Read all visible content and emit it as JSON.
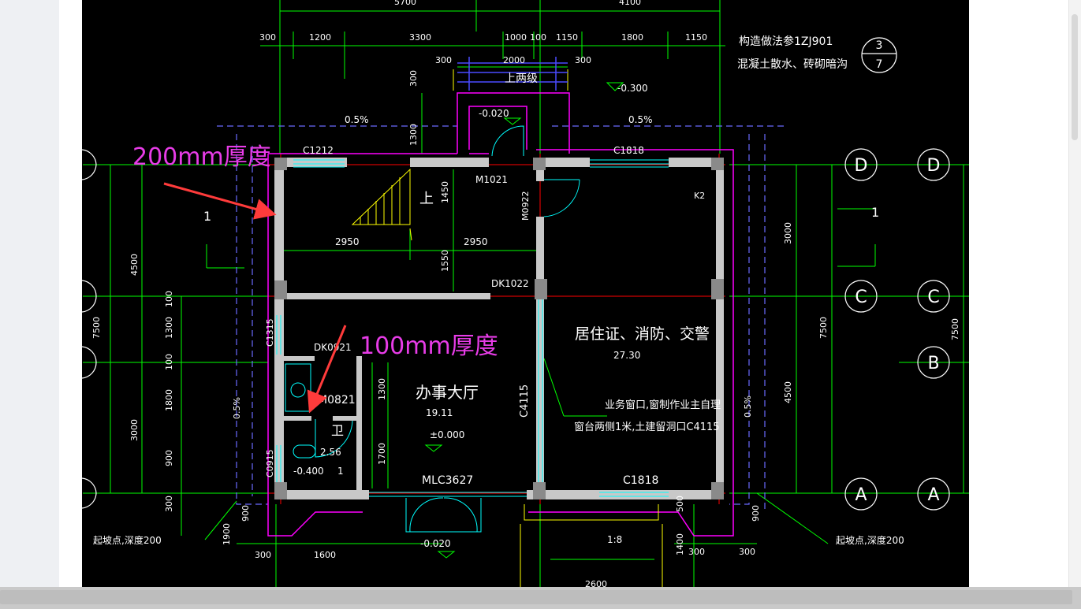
{
  "annotations": {
    "wall_200": "200mm厚度",
    "wall_100": "100mm厚度"
  },
  "notes": {
    "construction_ref": "构造做法参1ZJ901",
    "construction_sub": "混凝土散水、砖砌暗沟",
    "detail_num": "3",
    "detail_sheet": "7",
    "window_note_1": "业务窗口,窗制作业主自理",
    "window_note_2": "窗台两侧1米,土建留洞口C4115",
    "scatter_left": "起坡点,深度200",
    "scatter_right": "起坡点,深度200"
  },
  "rooms": {
    "hall": "办事大厅",
    "hall_area": "19.11",
    "hall_elev": "±0.000",
    "office": "居住证、消防、交警",
    "office_area": "27.30",
    "toilet_area": "2.56",
    "toilet_elev": "-0.400",
    "steps": "上两级",
    "stair_up": "上",
    "tag_1": "1",
    "tag_gong": "1",
    "tag_wei": "卫"
  },
  "grid": {
    "D": "D",
    "C": "C",
    "B": "B",
    "A": "A",
    "sec_left": "1",
    "sec_right": "1"
  },
  "openings": {
    "c1212": "C1212",
    "c1818_top": "C1818",
    "m1021": "M1021",
    "m0922": "M0922",
    "dk1022": "DK1022",
    "c1315": "C1315",
    "dk0921": "DK0921",
    "m0821": "M0821",
    "c4115": "C4115",
    "c0915": "C0915",
    "mlc3627": "MLC3627",
    "c1818_bot": "C1818",
    "k2": "K2"
  },
  "elevations": {
    "top_step": "-0.300",
    "porch": "-0.020",
    "front": "-0.020",
    "slope_left": "0.5%",
    "slope_right": "0.5%",
    "slope_v_left": "0.5%",
    "slope_v_right": "0.5%",
    "ramp": "1:8"
  },
  "dims_top": [
    "300",
    "1200",
    "3300",
    "1000",
    "100",
    "1150",
    "1800",
    "1150"
  ],
  "dims_top2": [
    "300",
    "2000",
    "300"
  ],
  "dims": {
    "d2950a": "2950",
    "d2950b": "2950",
    "d1450": "1450",
    "d1550": "1550",
    "d4500L": "4500",
    "d7500L": "7500",
    "d100a": "100",
    "d1300": "1300",
    "d100b": "100",
    "d1800": "1800",
    "d3000L": "3000",
    "d900L": "900",
    "d300L": "300",
    "d1300b": "1300",
    "d1700": "1700",
    "d3000R": "3000",
    "d7500R": "7500",
    "d4500R": "4500",
    "d7500RR": "7500",
    "d300top": "300",
    "d1300top": "1300",
    "d900a": "900",
    "d1900": "1900",
    "d300b": "300",
    "d1600": "1600",
    "d500": "500",
    "d1400": "1400",
    "d300c": "300",
    "d300d": "300",
    "d900b": "900",
    "d2600": "2600",
    "d5700": "5700",
    "d4100": "4100"
  },
  "colors": {
    "grid_line": "#00ff00",
    "axis_red": "#ff0000",
    "wall_magenta": "#ff00ff",
    "window_cyan": "#00ffff",
    "dashed_blue": "#6a6aff",
    "annotation": "#e83ce8",
    "arrow": "#ff3b3b"
  }
}
